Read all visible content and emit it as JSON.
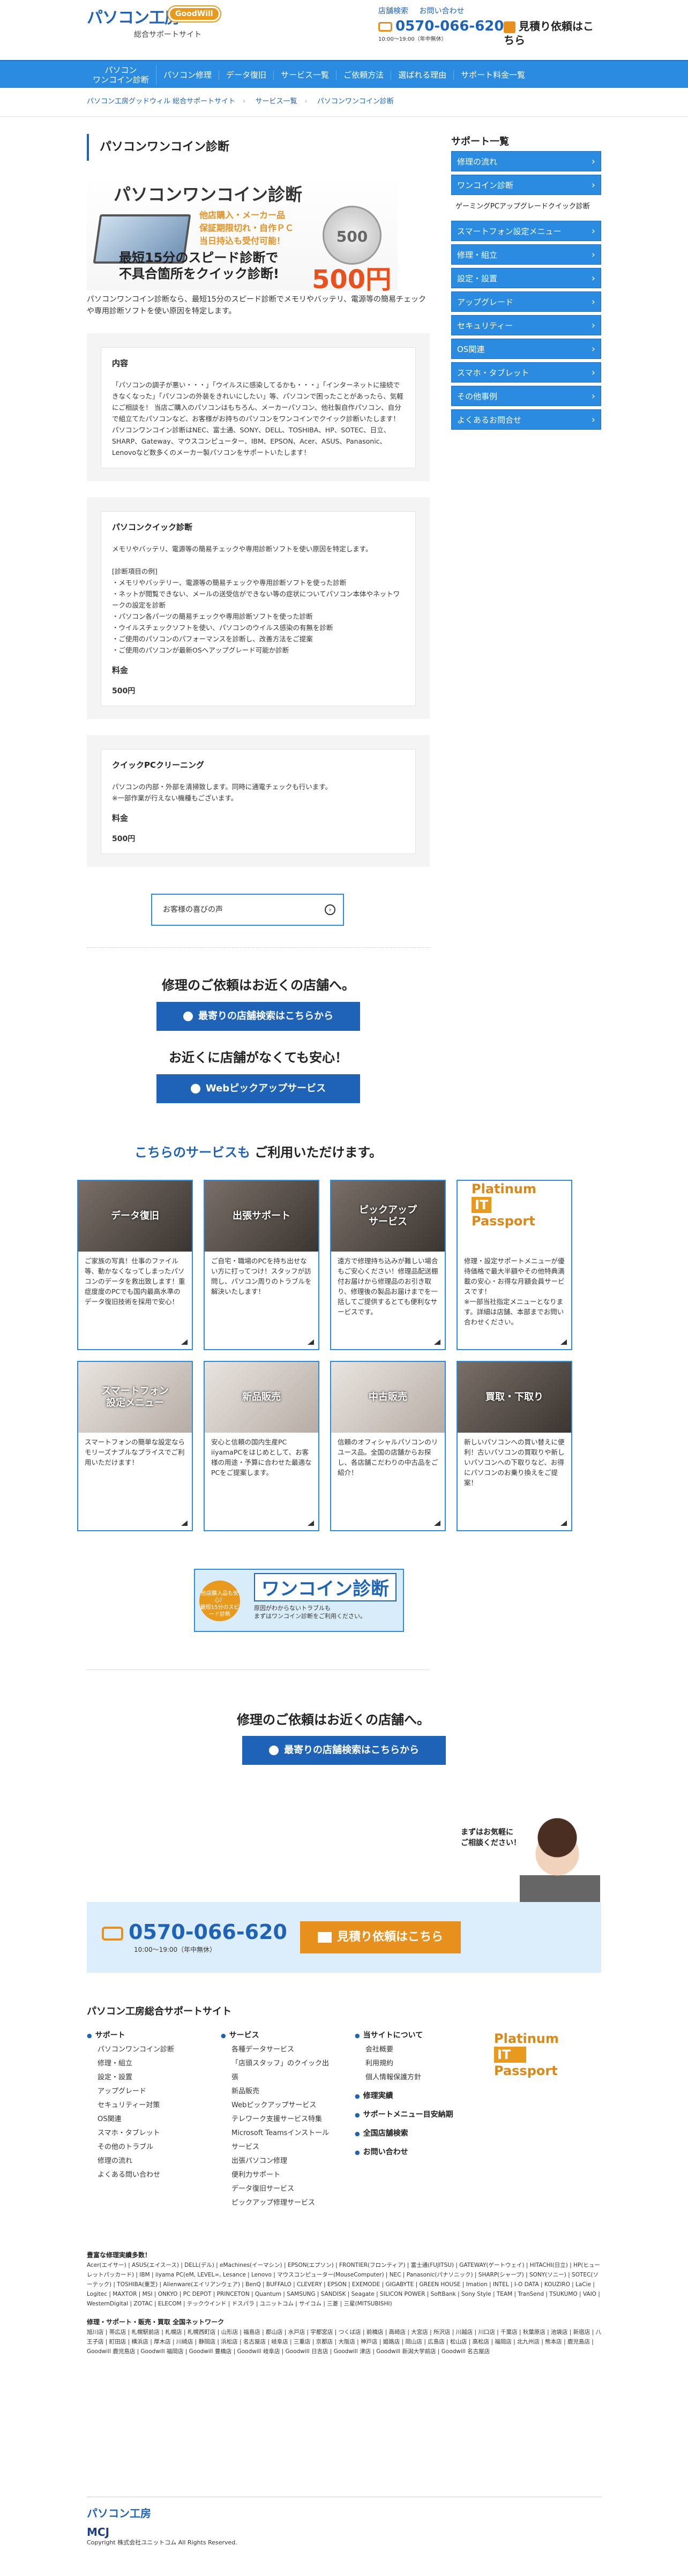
{
  "header": {
    "logo_text": "パソコン工房",
    "logo_badge": "GoodWill",
    "site_sub": "総合サポートサイト",
    "store_search": "店舗検索",
    "contact_label": "お問い合わせ",
    "tel": "0570-066-620",
    "hours": "10:00〜19:00（年中無休）",
    "quote_button": "見積り依頼はこちら"
  },
  "nav": [
    {
      "label": "パソコン\nワンコイン診断"
    },
    {
      "label": "パソコン修理"
    },
    {
      "label": "データ復旧"
    },
    {
      "label": "サービス一覧"
    },
    {
      "label": "ご依頼方法"
    },
    {
      "label": "選ばれる理由"
    },
    {
      "label": "サポート料金一覧"
    }
  ],
  "breadcrumb": [
    "パソコン工房グッドウィル 総合サポートサイト",
    "サービス一覧",
    "パソコンワンコイン診断"
  ],
  "page_title": "パソコンワンコイン診断",
  "hero": {
    "title": "パソコンワンコイン診断",
    "points": "他店購入・メーカー品\n保証期限切れ・自作ＰＣ\n当日持込も受付可能！",
    "coin": "500",
    "catch": "最短15分のスピード診断で\n不具合箇所をクイック診断!",
    "price": "500円"
  },
  "lead": "パソコンワンコイン診断なら、最短15分のスピード診断でメモリやバッテリ、電源等の簡易チェックや専用診断ソフトを使い原因を特定します。",
  "box1": {
    "title": "内容",
    "text": "「パソコンの調子が悪い・・・」「ウイルスに感染してるかも・・・」「インターネットに接続できなくなった」「パソコンの外装をきれいにしたい」等、パソコンで困ったことがあったら、気軽にご相談を！ 当店ご購入のパソコンはもちろん、メーカーパソコン、他社製自作パソコン、自分で組立てたパソコンなど、お客様がお持ちのパソコンをワンコインでクイック診断いたします！\nパソコンワンコイン診断はNEC、富士通、SONY、DELL、TOSHIBA、HP、SOTEC、日立、SHARP、Gateway、マウスコンピューター、IBM、EPSON、Acer、ASUS、Panasonic、Lenovoなど数多くのメーカー製パソコンをサポートいたします！"
  },
  "box2": {
    "title": "パソコンクイック診断",
    "text": "メモリやバッテリ、電源等の簡易チェックや専用診断ソフトを使い原因を特定します。\n\n[診断項目の例]\n・メモリやバッテリー、電源等の簡易チェックや専用診断ソフトを使った診断\n・ネットが閲覧できない、メールの送受信ができない等の症状についてパソコン本体やネットワークの設定を診断\n・パソコン各パーツの簡易チェックや専用診断ソフトを使った診断\n・ウイルスチェックソフトを使い、パソコンのウイルス感染の有無を診断\n・ご使用のパソコンのパフォーマンスを診断し、改善方法をご提案\n・ご使用のパソコンが最新OSへアップグレード可能か診断",
    "fee_label": "料金",
    "fee": "500円"
  },
  "box3": {
    "title": "クイックPCクリーニング",
    "text": "パソコンの内部・外部を清掃致します。同時に通電チェックも行います。\n※一部作業が行えない機種もございます。",
    "fee_label": "料金",
    "fee": "500円"
  },
  "voice_link": "お客様の喜びの声",
  "cta1": "修理のご依頼はお近くの店舗へ。",
  "cta1_button": "最寄りの店舗検索はこちらから",
  "cta2": "お近くに店舗がなくても安心！",
  "cta2_button": "Webピックアップサービス",
  "services_heading_pre": "こちらのサービスも",
  "services_heading_post": "ご利用いただけます。",
  "services": [
    {
      "name": "データ復旧",
      "text": "ご家族の写真！仕事のファイル等、動かなくなってしまったパソコンのデータを救出致します！重症度度のPCでも国内最高水準のデータ復旧技術を採用で安心！"
    },
    {
      "name": "出張サポート",
      "text": "ご自宅・職場のPCを持ち出せない方に打ってつけ！スタッフが訪問し、パソコン周りのトラブルを解決いたします！"
    },
    {
      "name": "ピックアップ\nサービス",
      "text": "遠方で修理持ち込みが難しい場合もご安心ください！修理品配送棚付お届けから修理品のお引き取り、修理後の製品お届けまでを一括してご提供するとても便利なサービスです。"
    },
    {
      "name": "Platinum IT Passport",
      "text": "修理・設定サポートメニューが優待価格で最大半額やその他特典満載の安心・お得な月額会員サービスです！\n※一部当社指定メニューとなります。詳細は店舗、本部までお問い合わせください。"
    },
    {
      "name": "スマートフォン\n設定メニュー",
      "text": "スマートフォンの簡単な設定ならモリーズナブルなプライスでご利用いただけます！"
    },
    {
      "name": "新品販売",
      "text": "安心と信頼の国内生産PC iiyamaPCをはじめとして、お客様の用途・予算に合わせた最適なPCをご提案します。"
    },
    {
      "name": "中古販売",
      "text": "信頼のオフィシャルパソコンのリユース品。全国の店舗からお探し、各店舗こだわりの中古品をご紹介！"
    },
    {
      "name": "買取・下取り",
      "text": "新しいパソコンへの買い替えに便利！古いパソコンの買取りや新しいパソコンへの下取りなど、お得にパソコンのお乗り換えをご提案！"
    }
  ],
  "banner": {
    "circle": "他店購入品も安心！\n最短15分のスピード診断",
    "title": "ワンコイン診断",
    "sub": "原因がわからないトラブルも\nまずはワンコイン診断をご利用ください。"
  },
  "footer_cta": "修理のご依頼はお近くの店舗へ。",
  "footer_cta_button": "最寄りの店舗検索はこちらから",
  "operator_bubble": "まずはお気軽に\nご相談ください！",
  "band": {
    "tel": "0570-066-620",
    "hours": "10:00〜19:00（年中無休）",
    "button": "見積り依頼はこちら"
  },
  "sidebar": {
    "heading": "サポート一覧",
    "items": [
      {
        "label": "修理の流れ"
      },
      {
        "label": "ワンコイン診断"
      },
      {
        "label": "ゲーミングPCアップグレードクイック診断",
        "sub": true
      },
      {
        "label": "スマートフォン設定メニュー"
      },
      {
        "label": "修理・組立"
      },
      {
        "label": "設定・設置"
      },
      {
        "label": "アップグレード"
      },
      {
        "label": "セキュリティー"
      },
      {
        "label": "OS関連"
      },
      {
        "label": "スマホ・タブレット"
      },
      {
        "label": "その他事例"
      },
      {
        "label": "よくあるお問合せ"
      }
    ]
  },
  "sitemap": {
    "title": "パソコン工房総合サポートサイト",
    "col1_head": "サポート",
    "col1": [
      "パソコンワンコイン診断",
      "修理・組立",
      "設定・設置",
      "アップグレード",
      "セキュリティー対策",
      "OS関連",
      "スマホ・タブレット",
      "その他のトラブル",
      "修理の流れ",
      "よくある問い合わせ"
    ],
    "col2_head": "サービス",
    "col2": [
      "各種データサービス",
      "「店頭スタッフ」のクイック出張",
      "新品販売",
      "Webピックアップサービス",
      "テレワーク支援サービス特集",
      "Microsoft Teamsインストールサービス",
      "出張パソコン修理",
      "便利力サポート",
      "データ復旧サービス",
      "ピックアップ修理サービス"
    ],
    "col3_head": "当サイトについて",
    "col3": [
      "会社概要",
      "利用規約",
      "個人情報保護方針"
    ],
    "col3_b": "修理実績",
    "col3_c": "サポートメニュー目安納期",
    "col3_d": "全国店舗検索",
    "col3_e": "お問い合わせ"
  },
  "makers": {
    "title": "豊富な修理実績多数！",
    "text": "Acer(エイサー) | ASUS(エイスース) | DELL(デル) | eMachines(イーマシン) | EPSON(エプソン) | FRONTIER(フロンティア) | 富士通(FUJITSU) | GATEWAY(ゲートウェイ) | HITACHI(日立) | HP(ヒューレットパッカード) | IBM | iiyama PC(eM, LEVEL∞, Lesance | Lenovo | マウスコンピューター(MouseComputer) | NEC | Panasonic(パナソニック) | SHARP(シャープ) | SONY(ソニー) | SOTEC(ソーテック) | TOSHIBA(東芝) | Alienware(エイリアンウェア) | BenQ | BUFFALO | CLEVERY | EPSON | EXEMODE | GIGABYTE | GREEN HOUSE | Imation | INTEL | I-O DATA | KOUZIRO | LaCie | Logitec | MAXTOR | MSI | ONKYO | PC DEPOT | PRINCETON | Quantum | SAMSUNG | SANDISK | Seagate | SILICON POWER | SoftBank | Sony Style | TEAM | TranSend | TSUKUMO | VAIO | WesternDigital | ZOTAC | ELECOM | テックウインド | ドスパラ | ユニットコム | サイコム | 三菱 | 三星(MITSUBISHI)",
    "repair_title": "修理・サポート・販売・買取 全国ネットワーク",
    "repair_text": "旭川店 | 帯広店 | 札幌駅前店 | 札幌店 | 札幌西町店 | 山形店 | 福島店 | 郡山店 | 水戸店 | 宇都宮店 | つくば店 | 前橋店 | 高崎店 | 大宮店 | 所沢店 | 川越店 | 川口店 | 千葉店 | 秋葉原店 | 池袋店 | 新宿店 | 八王子店 | 町田店 | 横浜店 | 厚木店 | 川崎店 | 静岡店 | 浜松店 | 名古屋店 | 岐阜店 | 三重店 | 京都店 | 大阪店 | 神戸店 | 姫路店 | 岡山店 | 広島店 | 松山店 | 高松店 | 福岡店 | 北九州店 | 熊本店 | 鹿児島店 | Goodwill 鹿児島店 | Goodwill 福岡店 | Goodwill 豊橋店 | Goodwill 岐阜店 | Goodwill 日吉店 | Goodwill 津店 | Goodwill 新潟大学前店 | Goodwill 名古屋店"
  },
  "footer_logo": "パソコン工房",
  "footer_company": "MCJ",
  "copyright": "Copyright 株式会社ユニットコム All Rights Reserved."
}
